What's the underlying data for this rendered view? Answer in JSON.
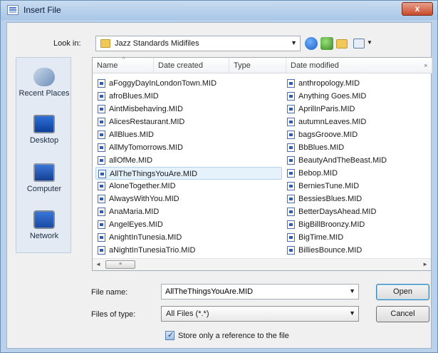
{
  "window": {
    "title": "Insert File",
    "close_label": "x"
  },
  "lookin": {
    "label": "Look in:",
    "folder": "Jazz Standards Midifiles",
    "arrow": "▼"
  },
  "toolbar": {
    "view_arrow": "▼"
  },
  "places": [
    {
      "label": "Recent Places",
      "icon": "recent-places-icon"
    },
    {
      "label": "Desktop",
      "icon": "desktop-icon"
    },
    {
      "label": "Computer",
      "icon": "computer-icon"
    },
    {
      "label": "Network",
      "icon": "network-icon"
    }
  ],
  "columns": {
    "name": "Name",
    "date_created": "Date created",
    "type": "Type",
    "date_modified": "Date modified",
    "sort_arrow": "^",
    "chevron": "»"
  },
  "files_left": [
    "aFoggyDayInLondonTown.MID",
    "afroBlues.MID",
    "AintMisbehaving.MID",
    "AlicesRestaurant.MID",
    "AllBlues.MID",
    "AllMyTomorrows.MID",
    "allOfMe.MID",
    "AllTheThingsYouAre.MID",
    "AloneTogether.MID",
    "AlwaysWithYou.MID",
    "AnaMaria.MID",
    "AngelEyes.MID",
    "AnightInTunesia.MID",
    "aNightInTunesiaTrio.MID"
  ],
  "files_right": [
    "anthropology.MID",
    "Anything Goes.MID",
    "AprilInParis.MID",
    "autumnLeaves.MID",
    "bagsGroove.MID",
    "BbBlues.MID",
    "BeautyAndTheBeast.MID",
    "Bebop.MID",
    "BerniesTune.MID",
    "BessiesBlues.MID",
    "BetterDaysAhead.MID",
    "BigBillBroonzy.MID",
    "BigTime.MID",
    "BilliesBounce.MID"
  ],
  "scroll": {
    "left": "◄",
    "right": "►",
    "thumb": "≡"
  },
  "filename": {
    "label": "File name:",
    "value": "AllTheThingsYouAre.MID",
    "arrow": "▼"
  },
  "filetype": {
    "label": "Files of type:",
    "value": "All Files (*.*)",
    "arrow": "▼"
  },
  "buttons": {
    "open": "Open",
    "cancel": "Cancel"
  },
  "checkbox": {
    "label": "Store only a reference to the file",
    "checked": true,
    "mark": "✓"
  },
  "selected_index": 7
}
